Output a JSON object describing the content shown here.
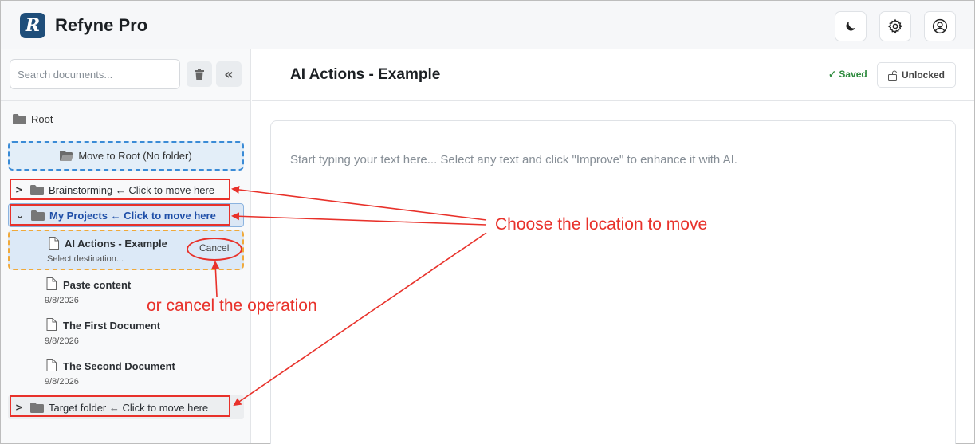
{
  "app": {
    "logo_letter": "R",
    "title": "Refyne Pro"
  },
  "header": {
    "icons": [
      "moon-icon",
      "gear-icon",
      "user-circle-icon"
    ]
  },
  "sidebar": {
    "search_placeholder": "Search documents...",
    "collapse_label": "«",
    "root_label": "Root",
    "move_root_label": "Move to Root (No folder)",
    "folders": [
      {
        "label": "Brainstorming ← Click to move here",
        "expanded": false
      },
      {
        "label": "My Projects ← Click to move here",
        "expanded": true
      },
      {
        "label": "Target folder ← Click to move here",
        "expanded": false
      }
    ],
    "moving_doc": {
      "title": "AI Actions - Example",
      "status": "Select destination...",
      "cancel_label": "Cancel"
    },
    "documents": [
      {
        "title": "Paste content",
        "date": "9/8/2026"
      },
      {
        "title": "The First Document",
        "date": "9/8/2026"
      },
      {
        "title": "The Second Document",
        "date": "9/8/2026"
      }
    ]
  },
  "main": {
    "title": "AI Actions - Example",
    "saved_label": "✓ Saved",
    "lock_label": "Unlocked",
    "editor_placeholder": "Start typing your text here... Select any text and click \"Improve\" to enhance it with AI."
  },
  "annotations": {
    "choose": "Choose the location to move",
    "cancel": "or cancel the operation",
    "color": "#e8312a"
  },
  "colors": {
    "accent": "#1f4e7a",
    "active_folder": "#1f4fa8",
    "saved": "#2e8b3e"
  }
}
